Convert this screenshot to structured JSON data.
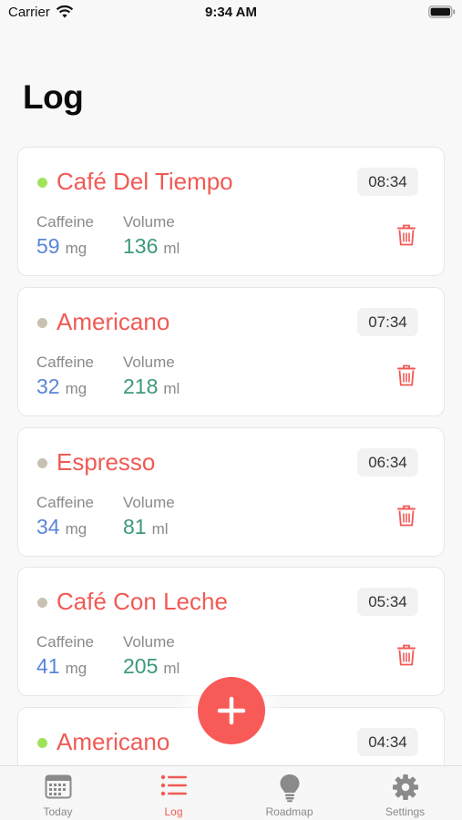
{
  "status_bar": {
    "carrier": "Carrier",
    "time": "9:34 AM"
  },
  "title": "Log",
  "colors": {
    "accent": "#f05a55",
    "caffeine": "#5a86d8",
    "volume": "#3b9a78",
    "dot_green": "#a0e35a",
    "dot_gray": "#c8c1b1"
  },
  "entries": [
    {
      "name": "Café Del Tiempo",
      "time": "08:34",
      "caffeine_label": "Caffeine",
      "caffeine": "59",
      "caffeine_unit": "mg",
      "volume_label": "Volume",
      "volume": "136",
      "volume_unit": "ml",
      "dot": "green"
    },
    {
      "name": "Americano",
      "time": "07:34",
      "caffeine_label": "Caffeine",
      "caffeine": "32",
      "caffeine_unit": "mg",
      "volume_label": "Volume",
      "volume": "218",
      "volume_unit": "ml",
      "dot": "gray"
    },
    {
      "name": "Espresso",
      "time": "06:34",
      "caffeine_label": "Caffeine",
      "caffeine": "34",
      "caffeine_unit": "mg",
      "volume_label": "Volume",
      "volume": "81",
      "volume_unit": "ml",
      "dot": "gray"
    },
    {
      "name": "Café Con Leche",
      "time": "05:34",
      "caffeine_label": "Caffeine",
      "caffeine": "41",
      "caffeine_unit": "mg",
      "volume_label": "Volume",
      "volume": "205",
      "volume_unit": "ml",
      "dot": "gray"
    },
    {
      "name": "Americano",
      "time": "04:34",
      "dot": "green"
    }
  ],
  "tabs": [
    {
      "label": "Today",
      "icon": "calendar-icon",
      "active": false
    },
    {
      "label": "Log",
      "icon": "list-icon",
      "active": true
    },
    {
      "label": "Roadmap",
      "icon": "lightbulb-icon",
      "active": false
    },
    {
      "label": "Settings",
      "icon": "gear-icon",
      "active": false
    }
  ]
}
